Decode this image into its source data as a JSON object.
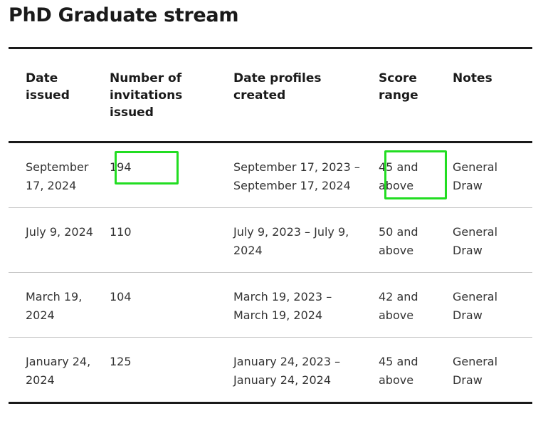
{
  "page": {
    "title": "PhD Graduate stream"
  },
  "table": {
    "headers": [
      "Date issued",
      "Number of invitations issued",
      "Date profiles created",
      "Score range",
      "Notes"
    ],
    "rows": [
      [
        "September 17, 2024",
        "194",
        "September 17, 2023 – September 17, 2024",
        "45 and above",
        "General Draw"
      ],
      [
        "July 9, 2024",
        "110",
        "July 9, 2023 – July 9, 2024",
        "50 and above",
        "General Draw"
      ],
      [
        "March 19, 2024",
        "104",
        "March 19, 2023 – March 19, 2024",
        "42 and above",
        "General Draw"
      ],
      [
        "January 24, 2024",
        "125",
        "January 24, 2023 – January 24, 2024",
        "45 and above",
        "General Draw"
      ]
    ]
  },
  "highlight": {
    "color": "#22dd22"
  }
}
